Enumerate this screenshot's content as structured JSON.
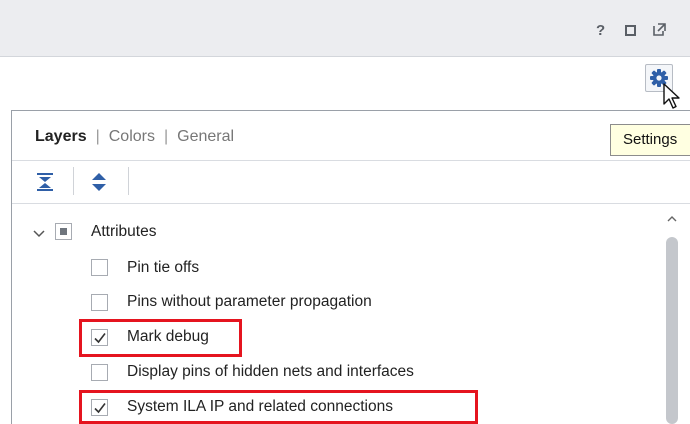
{
  "window": {
    "help_label": "?",
    "icons": [
      "question-icon",
      "maximize-icon",
      "undock-icon"
    ]
  },
  "toolbar": {
    "settings_icon": "gear-icon"
  },
  "tooltip": {
    "text": "Settings"
  },
  "tabs": [
    {
      "label": "Layers",
      "active": true
    },
    {
      "label": "Colors",
      "active": false
    },
    {
      "label": "General",
      "active": false
    }
  ],
  "tab_separator": "|",
  "layer_tools": [
    "collapse-all-icon",
    "expand-all-icon"
  ],
  "tree": {
    "group": {
      "label": "Attributes",
      "state": "partial",
      "expanded": true
    },
    "items": [
      {
        "label": "Pin tie offs",
        "checked": false,
        "highlighted": false
      },
      {
        "label": "Pins without parameter propagation",
        "checked": false,
        "highlighted": false
      },
      {
        "label": "Mark debug",
        "checked": true,
        "highlighted": true
      },
      {
        "label": "Display pins of hidden nets and interfaces",
        "checked": false,
        "highlighted": false
      },
      {
        "label": "System ILA IP and related connections",
        "checked": true,
        "highlighted": true
      }
    ]
  },
  "colors": {
    "highlight": "#e5141f",
    "tooltip_bg": "#ffffe1",
    "titlebar_bg": "#ecedf0"
  }
}
